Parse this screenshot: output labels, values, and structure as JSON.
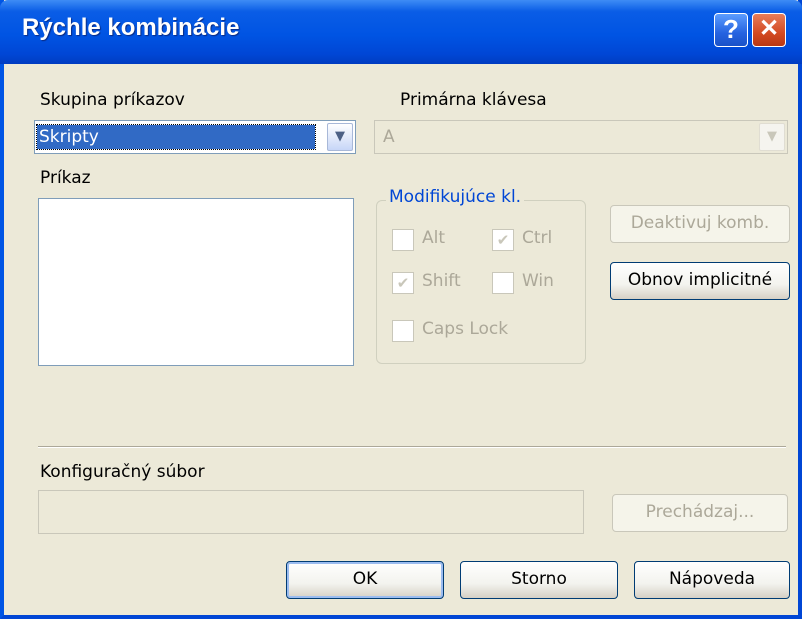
{
  "window": {
    "title": "Rýchle kombinácie",
    "help_label": "?",
    "close_label": "✕"
  },
  "command_group": {
    "label": "Skupina príkazov",
    "value": "Skripty"
  },
  "primary_key": {
    "label": "Primárna klávesa",
    "value": "A"
  },
  "command": {
    "label": "Príkaz",
    "items": []
  },
  "modifiers": {
    "title": "Modifikujúce kl.",
    "alt": {
      "label": "Alt",
      "checked": false
    },
    "ctrl": {
      "label": "Ctrl",
      "checked": true
    },
    "shift": {
      "label": "Shift",
      "checked": true
    },
    "win": {
      "label": "Win",
      "checked": false
    },
    "caps_lock": {
      "label": "Caps Lock",
      "checked": false
    }
  },
  "buttons": {
    "deactivate": "Deaktivuj komb.",
    "restore_defaults": "Obnov implicitné",
    "browse": "Prechádzaj...",
    "ok": "OK",
    "cancel": "Storno",
    "help": "Nápoveda"
  },
  "config_file": {
    "label": "Konfiguračný súbor",
    "value": ""
  },
  "icons": {
    "dropdown": "chevron-down-icon",
    "check": "checkmark-icon",
    "help": "question-icon",
    "close": "close-icon"
  },
  "colors": {
    "titlebar": "#0054e3",
    "dialog_bg": "#ece9d8",
    "selection": "#316ac5",
    "group_title": "#0046d5",
    "close_button": "#d34a22"
  }
}
